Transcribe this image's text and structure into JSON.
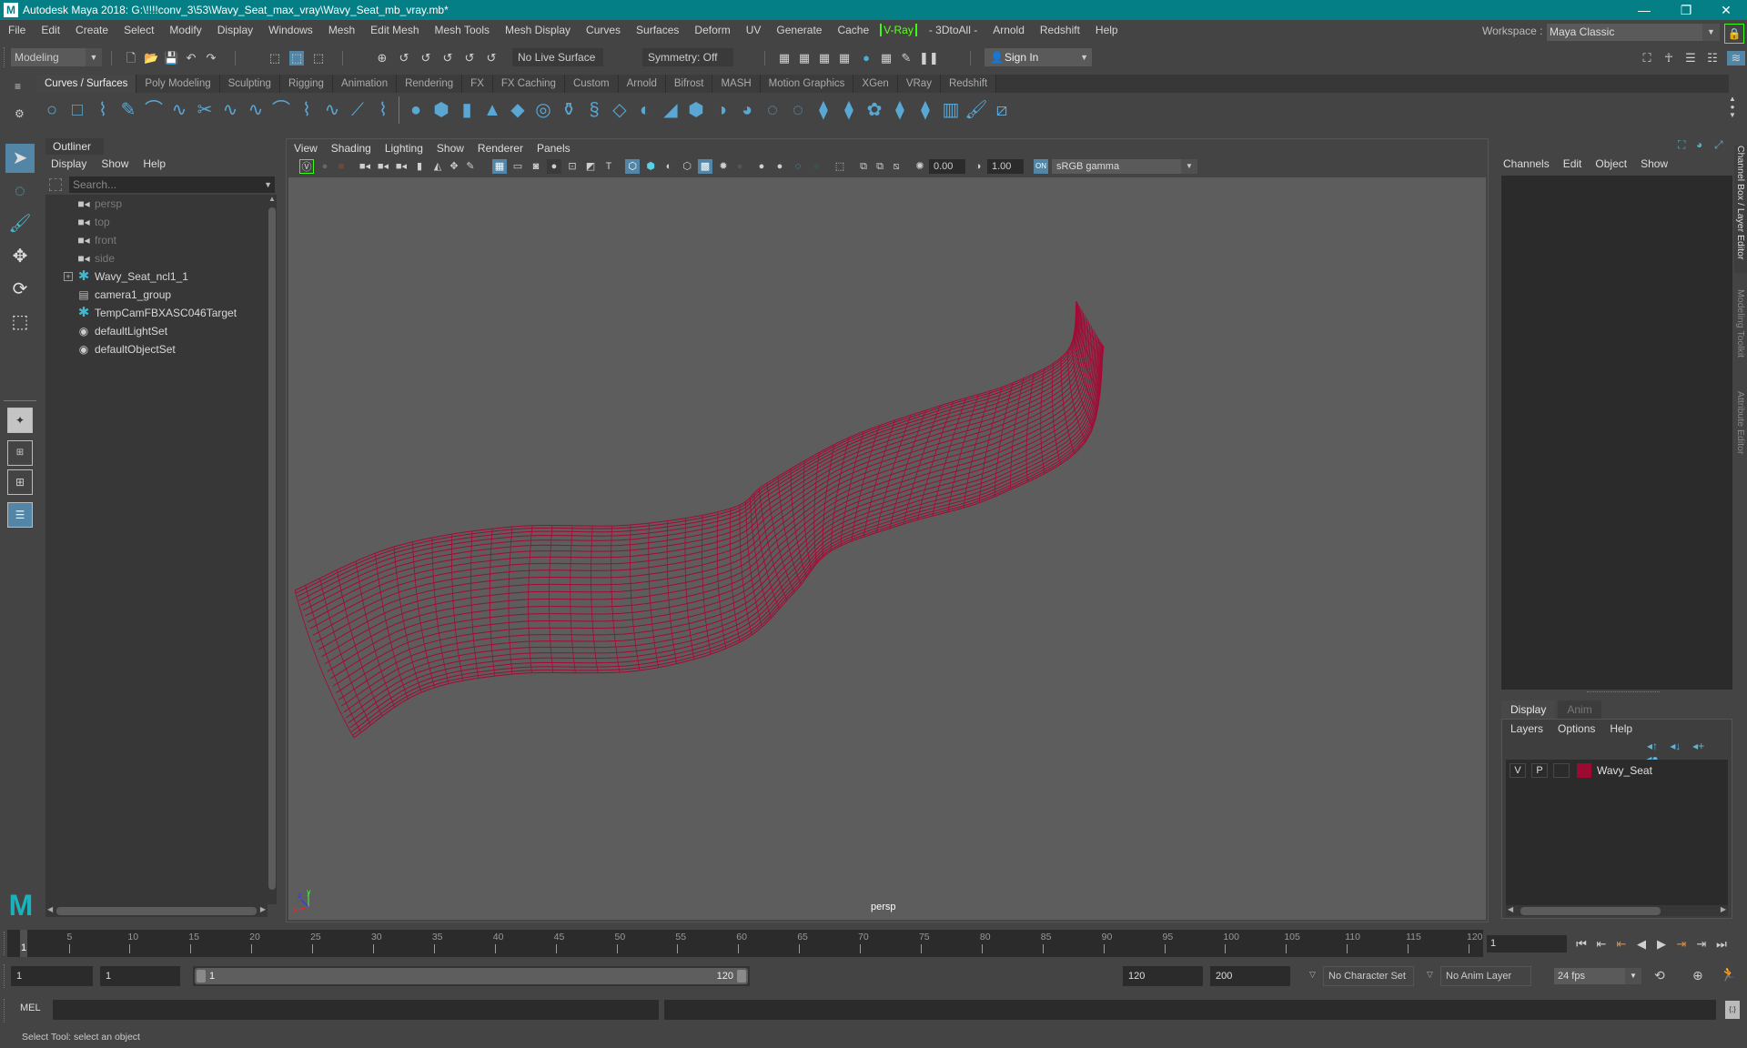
{
  "window": {
    "title": "Autodesk Maya 2018: G:\\!!!!conv_3\\53\\Wavy_Seat_max_vray\\Wavy_Seat_mb_vray.mb*",
    "app_icon": "M",
    "controls": {
      "minimize": "—",
      "maximize": "❐",
      "close": "✕"
    }
  },
  "menubar": {
    "items": [
      "File",
      "Edit",
      "Create",
      "Select",
      "Modify",
      "Display",
      "Windows",
      "Mesh",
      "Edit Mesh",
      "Mesh Tools",
      "Mesh Display",
      "Curves",
      "Surfaces",
      "Deform",
      "UV",
      "Generate",
      "Cache"
    ],
    "vray": "V-Ray",
    "items_after": [
      "- 3DtoAll -",
      "Arnold",
      "Redshift",
      "Help"
    ],
    "workspace_label": "Workspace :",
    "workspace_value": "Maya Classic"
  },
  "statusline": {
    "mode": "Modeling",
    "live_surface": "No Live Surface",
    "symmetry": "Symmetry: Off",
    "sign_in": "Sign In"
  },
  "shelf": {
    "tabs": [
      "Curves / Surfaces",
      "Poly Modeling",
      "Sculpting",
      "Rigging",
      "Animation",
      "Rendering",
      "FX",
      "FX Caching",
      "Custom",
      "Arnold",
      "Bifrost",
      "MASH",
      "Motion Graphics",
      "XGen",
      "VRay",
      "Redshift"
    ],
    "active_tab": "Curves / Surfaces"
  },
  "outliner": {
    "title": "Outliner",
    "menu": [
      "Display",
      "Show",
      "Help"
    ],
    "search_placeholder": "Search...",
    "items": [
      {
        "label": "persp",
        "type": "camera"
      },
      {
        "label": "top",
        "type": "camera"
      },
      {
        "label": "front",
        "type": "camera"
      },
      {
        "label": "side",
        "type": "camera"
      },
      {
        "label": "Wavy_Seat_ncl1_1",
        "type": "transform",
        "expandable": true
      },
      {
        "label": "camera1_group",
        "type": "group"
      },
      {
        "label": "TempCamFBXASC046Target",
        "type": "transform"
      },
      {
        "label": "defaultLightSet",
        "type": "set"
      },
      {
        "label": "defaultObjectSet",
        "type": "set"
      }
    ]
  },
  "viewport": {
    "menu": [
      "View",
      "Shading",
      "Lighting",
      "Show",
      "Renderer",
      "Panels"
    ],
    "exposure": "0.00",
    "gamma": "1.00",
    "color_space": "sRGB gamma",
    "camera_label": "persp",
    "axis": {
      "x": "x",
      "y": "y",
      "z": "z"
    },
    "wireframe_color": "#a30a35",
    "background_color": "#5d5d5d"
  },
  "channel_box": {
    "menu": [
      "Channels",
      "Edit",
      "Object",
      "Show"
    ],
    "side_tabs": [
      "Channel Box / Layer Editor",
      "Modeling Toolkit",
      "Attribute Editor"
    ]
  },
  "layer_editor": {
    "tabs": [
      "Display",
      "Anim"
    ],
    "menu": [
      "Layers",
      "Options",
      "Help"
    ],
    "layers": [
      {
        "v": "V",
        "p": "P",
        "name": "Wavy_Seat",
        "color": "#9b0a30"
      }
    ]
  },
  "timeline": {
    "start": 1,
    "end": 120,
    "ticks": [
      5,
      10,
      15,
      20,
      25,
      30,
      35,
      40,
      45,
      50,
      55,
      60,
      65,
      70,
      75,
      80,
      85,
      90,
      95,
      100,
      105,
      110,
      115,
      120
    ],
    "current_frame": "1",
    "current_frame_field": "1"
  },
  "range": {
    "start_field": "1",
    "playback_start_field": "1",
    "slider_min_label": "1",
    "slider_max_label": "120",
    "playback_end_field": "120",
    "end_field": "200",
    "character_set": "No Character Set",
    "anim_layer": "No Anim Layer",
    "fps": "24 fps"
  },
  "command_line": {
    "label": "MEL"
  },
  "help_line": {
    "text": "Select Tool: select an object"
  }
}
